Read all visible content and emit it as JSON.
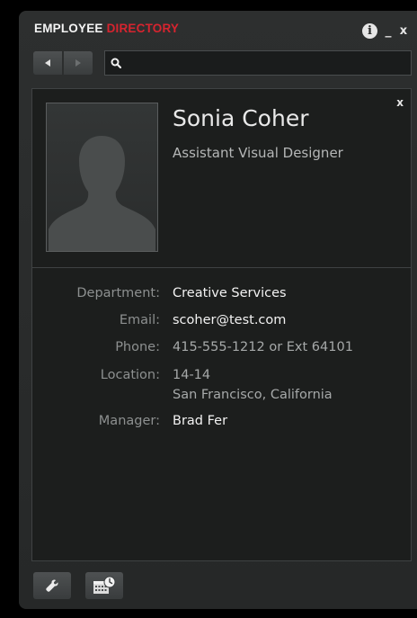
{
  "app": {
    "title_part1": "EMPLOYEE",
    "title_part2": "DIRECTORY",
    "accent_color": "#d7242f"
  },
  "window_controls": {
    "info_icon": "info-icon",
    "minimize_label": "_",
    "close_label": "x"
  },
  "nav": {
    "back_icon": "triangle-left-icon",
    "forward_icon": "triangle-right-icon"
  },
  "search": {
    "value": "",
    "placeholder": "",
    "icon": "search-icon"
  },
  "profile": {
    "close_label": "x",
    "name": "Sonia Coher",
    "title": "Assistant Visual Designer",
    "photo_icon": "person-silhouette-icon",
    "fields": [
      {
        "label": "Department:",
        "value": "Creative Services"
      },
      {
        "label": "Email:",
        "value": "scoher@test.com"
      },
      {
        "label": "Phone:",
        "value": "415-555-1212 or Ext 64101"
      },
      {
        "label": "Location:",
        "value_line1": "14-14",
        "value_line2": "San Francisco, California"
      },
      {
        "label": "Manager:",
        "value": "Brad Fer"
      }
    ]
  },
  "toolbar": {
    "settings_icon": "wrench-icon",
    "calendar_icon": "calendar-clock-icon"
  }
}
